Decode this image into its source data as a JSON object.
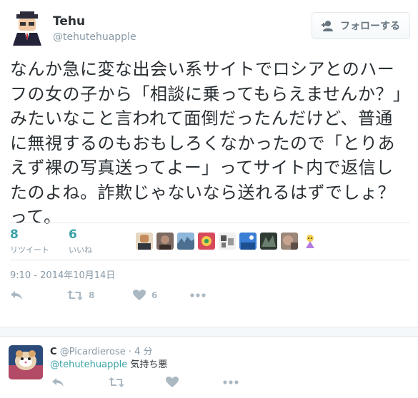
{
  "tweet": {
    "user_name": "Tehu",
    "handle": "@tehutehuapple",
    "follow_label": "フォローする",
    "text": "なんか急に変な出会い系サイトでロシアとのハーフの女の子から「相談に乗ってもらえませんか？」みたいなこと言われて面倒だったんだけど、普通に無視するのもおもしろくなかったので「とりあえず裸の写真送ってよー」ってサイト内で返信したのよね。詐欺じゃないなら送れるはずでしょ？って。",
    "stats": {
      "retweets_count": "8",
      "retweets_label": "リツイート",
      "likes_count": "6",
      "likes_label": "いいね"
    },
    "timestamp": "9:10 - 2014年10月14日",
    "actions": {
      "retweet_count": "8",
      "like_count": "6"
    }
  },
  "reply": {
    "name": "C",
    "handle": "@Picardierose",
    "time": "· 4 分",
    "mention": "@tehutehuapple",
    "text": "気持ち悪"
  },
  "colors": {
    "accent": "#3aa2a6",
    "muted": "#8899a6",
    "icon": "#aab8c2",
    "text": "#292f33"
  }
}
